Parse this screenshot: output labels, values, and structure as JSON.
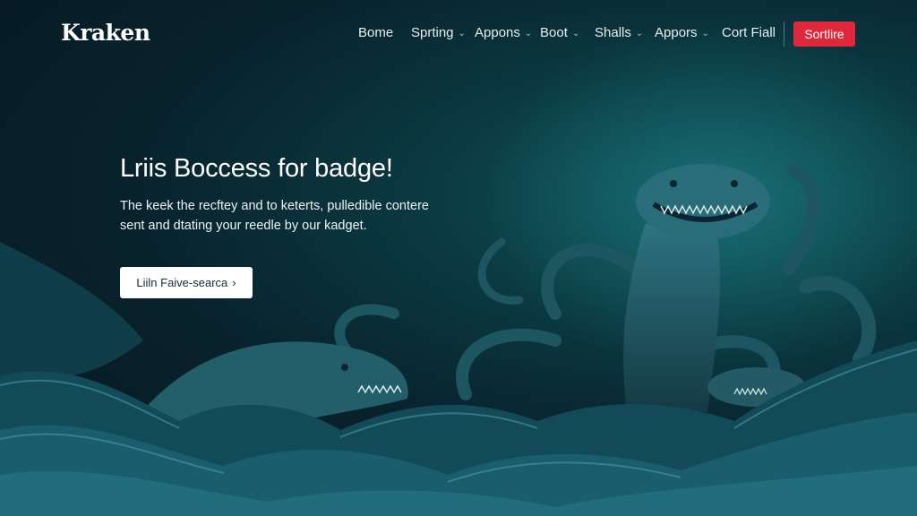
{
  "brand": {
    "logo_text": "Kraken"
  },
  "nav": {
    "items": [
      {
        "label": "Bome",
        "has_dropdown": false
      },
      {
        "label": "Sprting",
        "has_dropdown": true
      },
      {
        "label": "Appons",
        "has_dropdown": true
      },
      {
        "label": "Boot",
        "has_dropdown": true
      },
      {
        "label": "Shalls",
        "has_dropdown": true
      },
      {
        "label": "Appors",
        "has_dropdown": true
      },
      {
        "label": "Cort Fiall",
        "has_dropdown": false
      }
    ],
    "cta_label": "Sortlire"
  },
  "hero": {
    "title": "Lriis Boccess for badge!",
    "description": "The keek the recftey and to keterts, pulledible contere sent and dtating your reedle by our kadget.",
    "button_label": "Liiln Faive-searca",
    "button_icon": "chevron-right-icon"
  },
  "theme": {
    "accent": "#e0283c",
    "background": "#08222c",
    "creature": "#1f5e6a"
  }
}
